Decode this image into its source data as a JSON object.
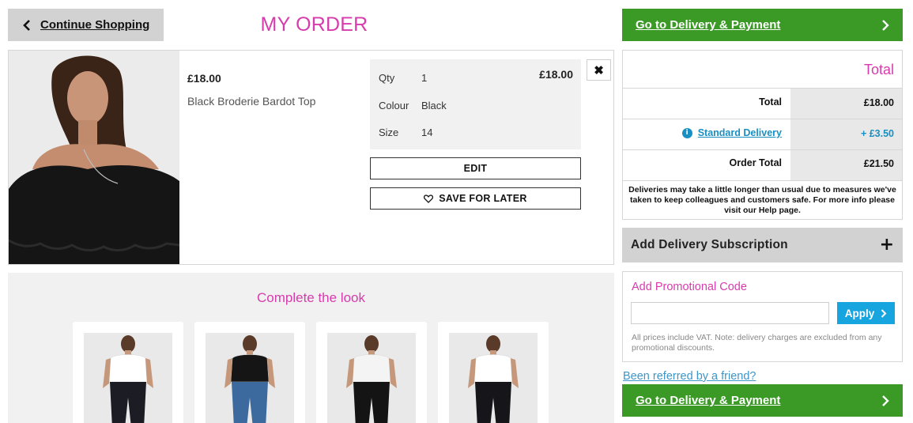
{
  "header": {
    "continue_label": "Continue Shopping",
    "title": "MY ORDER",
    "checkout_label": "Go to Delivery & Payment"
  },
  "item": {
    "price": "£18.00",
    "name": "Black Broderie Bardot Top",
    "details": {
      "qty_label": "Qty",
      "qty_value": "1",
      "colour_label": "Colour",
      "colour_value": "Black",
      "size_label": "Size",
      "size_value": "14",
      "line_price": "£18.00"
    },
    "remove_glyph": "✖",
    "edit_label": "EDIT",
    "save_label": "SAVE FOR LATER"
  },
  "complete_look": {
    "title": "Complete the look",
    "cards": [
      {
        "top_color": "#ffffff",
        "pants_color": "#1c1d24"
      },
      {
        "top_color": "#151515",
        "pants_color": "#3d6a9e"
      },
      {
        "top_color": "#f4f4f4",
        "pants_color": "#141414"
      },
      {
        "top_color": "#ffffff",
        "pants_color": "#15151a"
      }
    ]
  },
  "summary": {
    "heading": "Total",
    "total_label": "Total",
    "total_value": "£18.00",
    "delivery_label": "Standard Delivery",
    "delivery_value": "+ £3.50",
    "order_total_label": "Order Total",
    "order_total_value": "£21.50",
    "notice": "Deliveries may take a little longer than usual due to measures we've taken to keep colleagues and customers safe. For more info please visit our Help page."
  },
  "subscription": {
    "label": "Add Delivery Subscription",
    "plus": "+"
  },
  "promo": {
    "title": "Add Promotional Code",
    "input_value": "",
    "apply_label": "Apply",
    "vat_note": "All prices include VAT. Note: delivery charges are excluded from any promotional discounts."
  },
  "referral_label": "Been referred by a friend?",
  "colors": {
    "accent_pink": "#d63cac",
    "cta_green": "#3a9a25",
    "link_blue": "#1a8fc1",
    "apply_blue": "#17a5e0"
  }
}
